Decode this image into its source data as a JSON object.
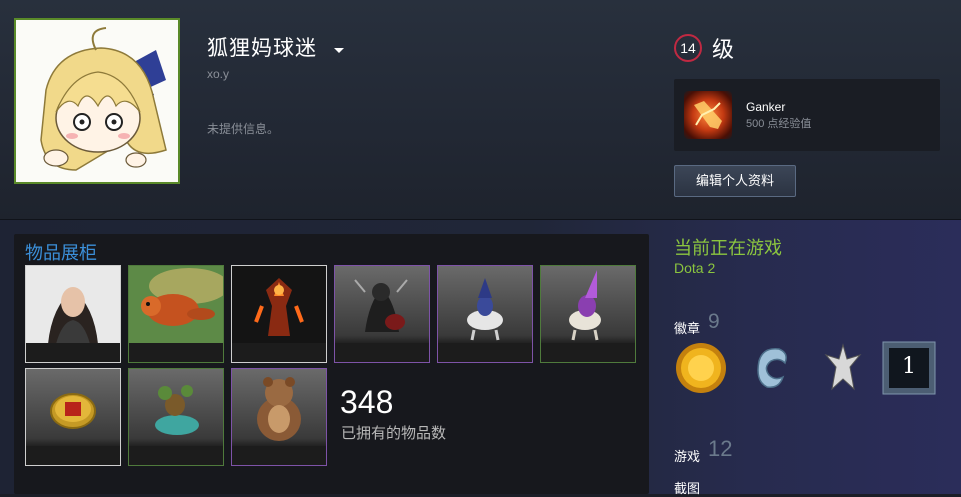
{
  "profile": {
    "persona_name": "狐狸妈球迷",
    "real_name": "xo.y",
    "summary": "未提供信息。",
    "level": "14",
    "level_suffix": "级",
    "featured_badge": {
      "name": "Ganker",
      "xp": "500 点经验值"
    },
    "edit_button": "编辑个人资料"
  },
  "showcase": {
    "title": "物品展柜",
    "items": [
      {
        "name": "avatar-photo",
        "quality": "white"
      },
      {
        "name": "red-panda",
        "quality": "green"
      },
      {
        "name": "fire-warrior",
        "quality": "white"
      },
      {
        "name": "dark-hero",
        "quality": "purple"
      },
      {
        "name": "wizard-rider",
        "quality": "purple"
      },
      {
        "name": "witch-rider",
        "quality": "green"
      },
      {
        "name": "dota-coin",
        "quality": "white"
      },
      {
        "name": "goblin-rider",
        "quality": "green"
      },
      {
        "name": "bear",
        "quality": "purple"
      }
    ],
    "count": "348",
    "count_label": "已拥有的物品数"
  },
  "sidebar": {
    "now_playing_label": "当前正在游戏",
    "game_name": "Dota 2",
    "badges_label": "徽章",
    "badges_count": "9",
    "badge_icons": [
      "gold-coin-icon",
      "dragon-icon",
      "skyrim-icon",
      "number-one-icon"
    ],
    "badge_number": "1",
    "games_label": "游戏",
    "games_count": "12",
    "screenshots_label": "截图"
  },
  "colors": {
    "accent_green": "#8bc53f",
    "accent_blue": "#3b8fd9",
    "level_ring": "#c02942",
    "avatar_border": "#5a8a29"
  }
}
